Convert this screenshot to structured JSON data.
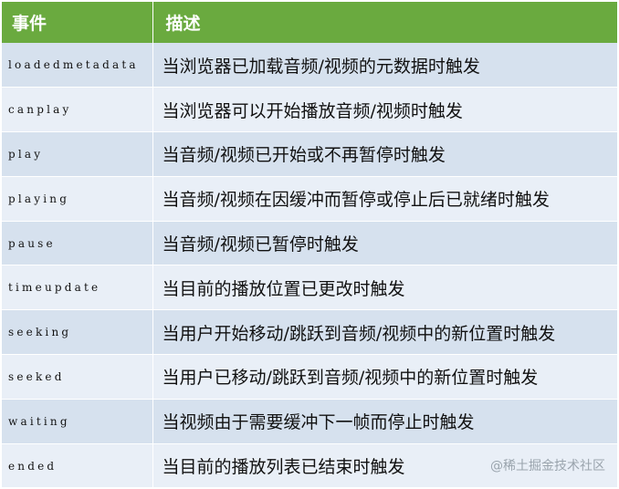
{
  "table": {
    "headers": {
      "event": "事件",
      "description": "描述"
    },
    "header_color": "#6aaa3f",
    "row_colors": [
      "#d6e1ee",
      "#e9eff7"
    ],
    "rows": [
      {
        "event": "loadedmetadata",
        "description": "当浏览器已加载音频/视频的元数据时触发"
      },
      {
        "event": "canplay",
        "description": "当浏览器可以开始播放音频/视频时触发"
      },
      {
        "event": "play",
        "description": "当音频/视频已开始或不再暂停时触发"
      },
      {
        "event": "playing",
        "description": "当音频/视频在因缓冲而暂停或停止后已就绪时触发"
      },
      {
        "event": "pause",
        "description": "当音频/视频已暂停时触发"
      },
      {
        "event": "timeupdate",
        "description": "当目前的播放位置已更改时触发"
      },
      {
        "event": "seeking",
        "description": "当用户开始移动/跳跃到音频/视频中的新位置时触发"
      },
      {
        "event": "seeked",
        "description": "当用户已移动/跳跃到音频/视频中的新位置时触发"
      },
      {
        "event": "waiting",
        "description": "当视频由于需要缓冲下一帧而停止时触发"
      },
      {
        "event": "ended",
        "description": "当目前的播放列表已结束时触发"
      }
    ]
  },
  "watermark": {
    "text": "@稀土掘金技术社区"
  }
}
